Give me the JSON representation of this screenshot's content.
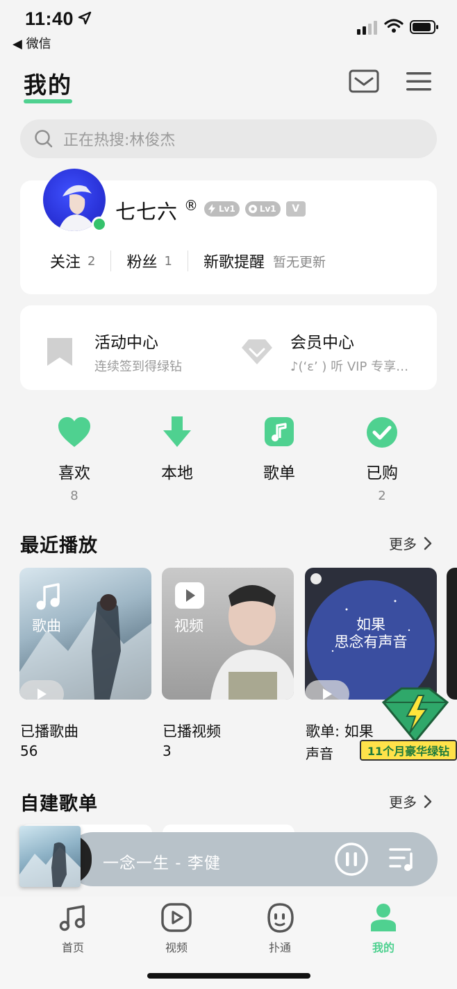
{
  "status_bar": {
    "time": "11:40",
    "back_label": "◀ 微信"
  },
  "header": {
    "title": "我的"
  },
  "search": {
    "placeholder": "正在热搜:林俊杰"
  },
  "profile": {
    "username": "七七六",
    "registered_mark": "®",
    "badges": [
      "Lv1",
      "Lv1",
      "V"
    ],
    "stats": [
      {
        "label": "关注",
        "count": "2"
      },
      {
        "label": "粉丝",
        "count": "1"
      },
      {
        "label": "新歌提醒",
        "hint": "暂无更新"
      }
    ]
  },
  "centers": [
    {
      "title": "活动中心",
      "subtitle": "连续签到得绿钻"
    },
    {
      "title": "会员中心",
      "subtitle": "♪(‘ε’ ) 听 VIP 专享…"
    }
  ],
  "quick_actions": [
    {
      "label": "喜欢",
      "count": "8",
      "icon": "heart-icon"
    },
    {
      "label": "本地",
      "count": "",
      "icon": "download-icon"
    },
    {
      "label": "歌单",
      "count": "",
      "icon": "playlist-icon"
    },
    {
      "label": "已购",
      "count": "2",
      "icon": "check-icon"
    }
  ],
  "recent": {
    "title": "最近播放",
    "more": "更多",
    "items": [
      {
        "tile_label": "歌曲",
        "caption": "已播歌曲",
        "sub": "56"
      },
      {
        "tile_label": "视频",
        "caption": "已播视频",
        "sub": "3"
      },
      {
        "tile_label": "如果\n思念有声音",
        "caption": "歌单: 如果",
        "sub": "声音"
      }
    ]
  },
  "promo": {
    "text": "11个月豪华绿钻"
  },
  "custom_playlists": {
    "title": "自建歌单",
    "more": "更多"
  },
  "player": {
    "track": "一念一生 - 李健"
  },
  "tabs": [
    {
      "label": "首页",
      "icon": "music-note-icon"
    },
    {
      "label": "视频",
      "icon": "video-icon"
    },
    {
      "label": "扑通",
      "icon": "face-icon"
    },
    {
      "label": "我的",
      "icon": "person-icon",
      "active": true
    }
  ],
  "colors": {
    "accent": "#4fd190",
    "text": "#111111",
    "muted": "#9b9b9b"
  }
}
